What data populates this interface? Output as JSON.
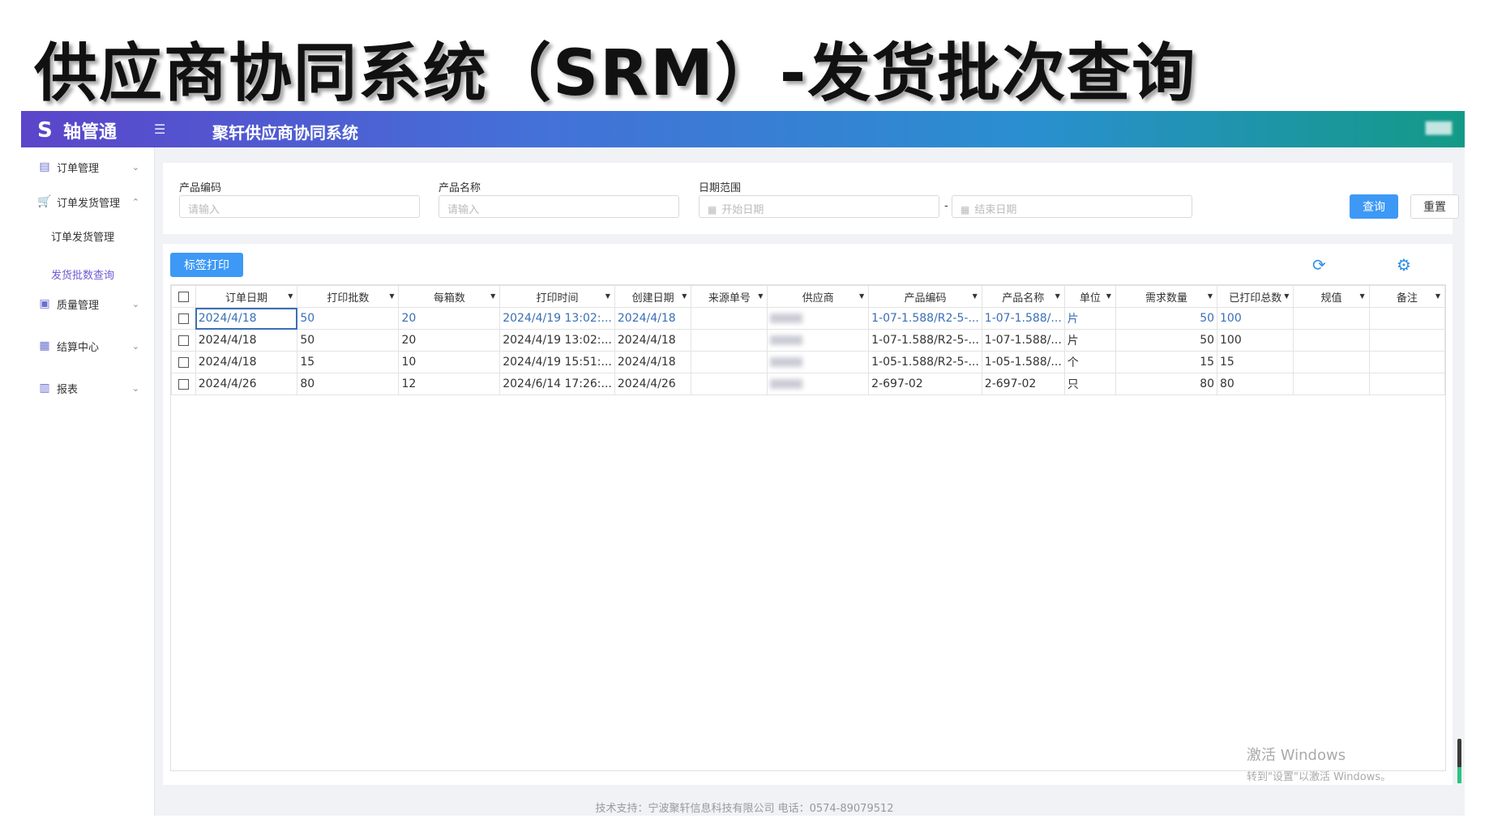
{
  "slide_title": "供应商协同系统（SRM）-发货批次查询",
  "header": {
    "logo_text": "轴管通",
    "system_title": "聚轩供应商协同系统",
    "user": "███"
  },
  "sidebar": {
    "items": [
      {
        "label": "订单管理",
        "icon": "document-icon"
      },
      {
        "label": "订单发货管理",
        "icon": "cart-icon"
      },
      {
        "label": "质量管理",
        "icon": "quality-icon"
      },
      {
        "label": "结算中心",
        "icon": "grid-icon"
      },
      {
        "label": "报表",
        "icon": "table-icon"
      }
    ],
    "subitems": [
      {
        "label": "订单发货管理"
      },
      {
        "label": "发货批数查询"
      }
    ]
  },
  "filters": {
    "product_code_label": "产品编码",
    "product_code_placeholder": "请输入",
    "product_name_label": "产品名称",
    "product_name_placeholder": "请输入",
    "date_range_label": "日期范围",
    "start_date_placeholder": "开始日期",
    "end_date_placeholder": "结束日期",
    "range_separator": "-",
    "query_label": "查询",
    "reset_label": "重置"
  },
  "toolbar": {
    "print_label": "标签打印"
  },
  "table": {
    "columns": [
      "订单日期",
      "打印批数",
      "每箱数",
      "打印时间",
      "创建日期",
      "来源单号",
      "供应商",
      "产品编码",
      "产品名称",
      "单位",
      "需求数量",
      "已打印总数",
      "规值",
      "备注"
    ],
    "rows": [
      {
        "order_date": "2024/4/18",
        "print_batches": "50",
        "per_box": "20",
        "print_time": "2024/4/19 13:02:...",
        "create_date": "2024/4/18",
        "source_no": "",
        "supplier": "",
        "product_code": "1-07-1.588/R2-5-...",
        "product_name": "1-07-1.588/...",
        "unit": "片",
        "demand_qty": "50",
        "printed_total": "100",
        "spec": "",
        "remark": ""
      },
      {
        "order_date": "2024/4/18",
        "print_batches": "50",
        "per_box": "20",
        "print_time": "2024/4/19 13:02:...",
        "create_date": "2024/4/18",
        "source_no": "",
        "supplier": "",
        "product_code": "1-07-1.588/R2-5-...",
        "product_name": "1-07-1.588/...",
        "unit": "片",
        "demand_qty": "50",
        "printed_total": "100",
        "spec": "",
        "remark": ""
      },
      {
        "order_date": "2024/4/18",
        "print_batches": "15",
        "per_box": "10",
        "print_time": "2024/4/19 15:51:...",
        "create_date": "2024/4/18",
        "source_no": "",
        "supplier": "",
        "product_code": "1-05-1.588/R2-5-...",
        "product_name": "1-05-1.588/...",
        "unit": "个",
        "demand_qty": "15",
        "printed_total": "15",
        "spec": "",
        "remark": ""
      },
      {
        "order_date": "2024/4/26",
        "print_batches": "80",
        "per_box": "12",
        "print_time": "2024/6/14 17:26:...",
        "create_date": "2024/4/26",
        "source_no": "",
        "supplier": "",
        "product_code": "2-697-02",
        "product_name": "2-697-02",
        "unit": "只",
        "demand_qty": "80",
        "printed_total": "80",
        "spec": "",
        "remark": ""
      }
    ]
  },
  "footer": "技术支持：宁波聚轩信息科技有限公司 电话：0574-89079512",
  "watermark": {
    "line1": "激活 Windows",
    "line2": "转到\"设置\"以激活 Windows。"
  },
  "colors": {
    "accent": "#3d99f5",
    "sidebar_active": "#6b5bd4",
    "highlight_row_text": "#3a6fb5"
  }
}
